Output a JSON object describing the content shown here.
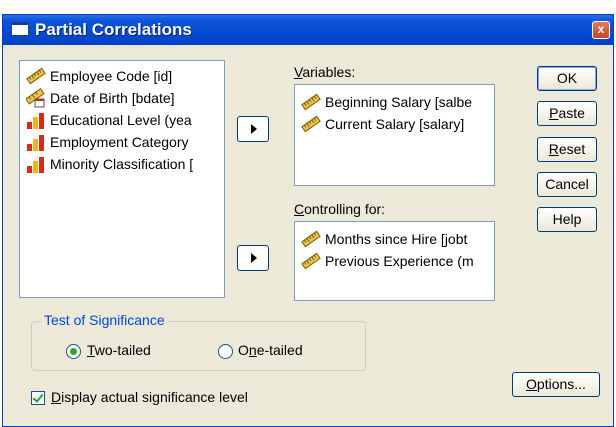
{
  "window": {
    "title": "Partial Correlations",
    "close_label": "x"
  },
  "source_list": [
    {
      "label": "Employee Code [id]",
      "icon": "ruler-icon"
    },
    {
      "label": "Date of Birth [bdate]",
      "icon": "ruler-date-icon"
    },
    {
      "label": "Educational Level (yea",
      "icon": "bar-chart-icon"
    },
    {
      "label": "Employment Category",
      "icon": "bar-chart-icon"
    },
    {
      "label": "Minority Classification [",
      "icon": "bar-chart-icon"
    }
  ],
  "variables": {
    "label_first": "V",
    "label_rest": "ariables:",
    "items": [
      {
        "label": "Beginning Salary [salbe",
        "icon": "ruler-icon"
      },
      {
        "label": "Current Salary [salary]",
        "icon": "ruler-icon"
      }
    ]
  },
  "controlling": {
    "label_first": "C",
    "label_rest": "ontrolling for:",
    "items": [
      {
        "label": "Months since Hire [jobt",
        "icon": "ruler-icon"
      },
      {
        "label": "Previous Experience (m",
        "icon": "ruler-icon"
      }
    ]
  },
  "buttons": {
    "ok": "OK",
    "paste_first": "P",
    "paste_rest": "aste",
    "reset_first": "R",
    "reset_rest": "eset",
    "cancel": "Cancel",
    "help": "Help",
    "options_first": "O",
    "options_rest": "ptions..."
  },
  "significance": {
    "legend": "Test of Significance",
    "two_first": "T",
    "two_rest": "wo-tailed",
    "one_prefix": "O",
    "one_under": "n",
    "one_rest": "e-tailed",
    "selected": "two-tailed"
  },
  "display_actual": {
    "label_first": "D",
    "label_rest": "isplay actual significance level",
    "checked": true
  },
  "colors": {
    "titlebar": "#0348cf",
    "dialog": "#ece9d8",
    "legend_text": "#0046d5",
    "radio_dot": "#2fa428"
  }
}
